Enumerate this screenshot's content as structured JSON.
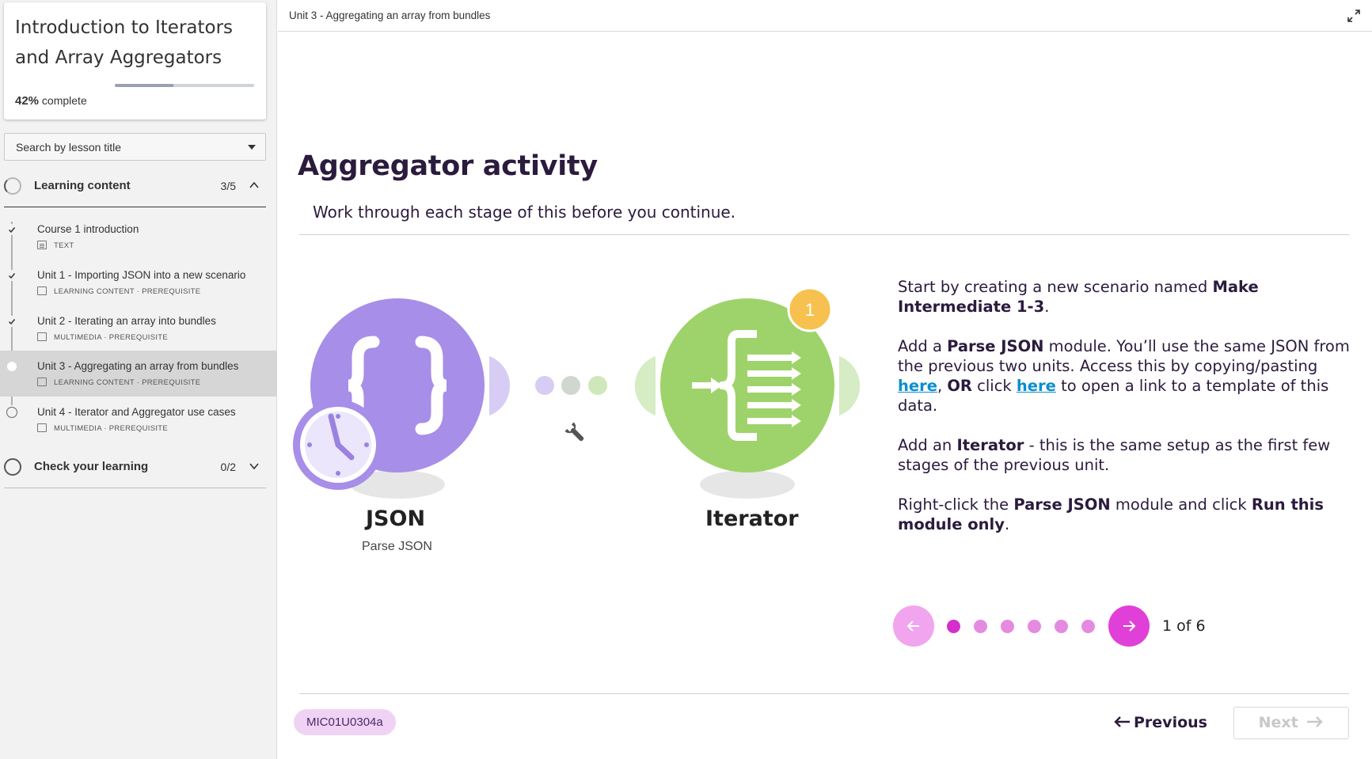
{
  "course": {
    "title": "Introduction to Iterators and Array Aggregators",
    "progress_percent": "42%",
    "progress_suffix": "complete",
    "progress_fraction": 0.42
  },
  "search": {
    "placeholder": "Search by lesson title"
  },
  "sections": [
    {
      "label": "Learning content",
      "count": "3/5",
      "expanded": true
    },
    {
      "label": "Check your learning",
      "count": "0/2",
      "expanded": false
    }
  ],
  "lessons": [
    {
      "title": "Course 1 introduction",
      "meta": "TEXT",
      "done": true,
      "meta_icon": "document-icon"
    },
    {
      "title": "Unit 1 - Importing JSON into a new scenario",
      "meta": "LEARNING CONTENT · PREREQUISITE",
      "done": true,
      "meta_icon": "media-icon"
    },
    {
      "title": "Unit 2 - Iterating an array into bundles",
      "meta": "MULTIMEDIA · PREREQUISITE",
      "done": true,
      "meta_icon": "media-icon"
    },
    {
      "title": "Unit 3 - Aggregating an array from bundles",
      "meta": "LEARNING CONTENT · PREREQUISITE",
      "done": false,
      "active": true,
      "meta_icon": "media-icon"
    },
    {
      "title": "Unit 4 - Iterator and Aggregator use cases",
      "meta": "MULTIMEDIA · PREREQUISITE",
      "done": false,
      "meta_icon": "media-icon"
    }
  ],
  "topbar": {
    "breadcrumb": "Unit 3 - Aggregating an array from bundles"
  },
  "main": {
    "heading": "Aggregator activity",
    "subheading": "Work through each stage of this before you continue."
  },
  "diagram": {
    "json_module": {
      "name": "JSON",
      "subtitle": "Parse JSON",
      "color": "#a78ee8"
    },
    "iterator_module": {
      "name": "Iterator",
      "badge": "1",
      "color": "#9ed36b"
    },
    "badge_color": "#f7c14f"
  },
  "instructions": {
    "p1_a": "Start by creating a new scenario named ",
    "p1_b": "Make Intermediate 1-3",
    "p1_c": ".",
    "p2_a": "Add a ",
    "p2_b": "Parse JSON",
    "p2_c": " module. You’ll use the same JSON from the previous two units. Access this by copying/pasting ",
    "p2_link1": "here",
    "p2_d": ", ",
    "p2_or": "OR",
    "p2_e": " click ",
    "p2_link2": "here",
    "p2_f": " to open a link to a template of this data.",
    "p3_a": "Add an ",
    "p3_b": "Iterator",
    "p3_c": " - this is the same setup as the first few stages of the previous unit.",
    "p4_a": "Right-click the ",
    "p4_b": "Parse JSON",
    "p4_c": " module and click ",
    "p4_d": "Run this module only",
    "p4_e": "."
  },
  "carousel": {
    "counter": "1 of 6",
    "current": 1,
    "total": 6
  },
  "footer": {
    "code": "MIC01U0304a",
    "previous_label": "Previous",
    "next_label": "Next"
  },
  "colors": {
    "accent_magenta": "#e040d8",
    "heading_purple": "#2b1b3d",
    "link_blue": "#0a8ecf"
  }
}
